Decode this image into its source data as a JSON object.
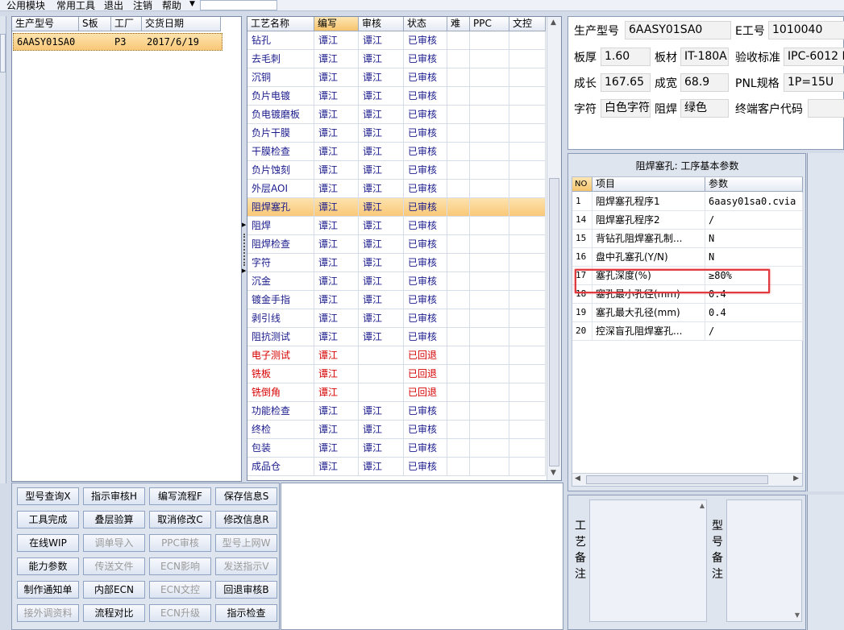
{
  "menu": [
    "公用模块",
    "常用工具",
    "退出",
    "注销",
    "帮助"
  ],
  "orders": {
    "headers": [
      "生产型号",
      "S板",
      "工厂",
      "交货日期"
    ],
    "rows": [
      [
        "6AASY01SA0",
        "",
        "P3",
        "2017/6/19"
      ]
    ]
  },
  "process": {
    "headers": [
      "工艺名称",
      "编写",
      "审核",
      "状态",
      "难",
      "PPC",
      "文控"
    ],
    "rows": [
      {
        "name": "钻孔",
        "writer": "谭江",
        "reviewer": "谭江",
        "status": "已审核"
      },
      {
        "name": "去毛刺",
        "writer": "谭江",
        "reviewer": "谭江",
        "status": "已审核"
      },
      {
        "name": "沉铜",
        "writer": "谭江",
        "reviewer": "谭江",
        "status": "已审核"
      },
      {
        "name": "负片电镀",
        "writer": "谭江",
        "reviewer": "谭江",
        "status": "已审核"
      },
      {
        "name": "负电镀磨板",
        "writer": "谭江",
        "reviewer": "谭江",
        "status": "已审核"
      },
      {
        "name": "负片干膜",
        "writer": "谭江",
        "reviewer": "谭江",
        "status": "已审核"
      },
      {
        "name": "干膜检查",
        "writer": "谭江",
        "reviewer": "谭江",
        "status": "已审核"
      },
      {
        "name": "负片蚀刻",
        "writer": "谭江",
        "reviewer": "谭江",
        "status": "已审核"
      },
      {
        "name": "外层AOI",
        "writer": "谭江",
        "reviewer": "谭江",
        "status": "已审核"
      },
      {
        "name": "阻焊塞孔",
        "writer": "谭江",
        "reviewer": "谭江",
        "status": "已审核"
      },
      {
        "name": "阻焊",
        "writer": "谭江",
        "reviewer": "谭江",
        "status": "已审核"
      },
      {
        "name": "阻焊检查",
        "writer": "谭江",
        "reviewer": "谭江",
        "status": "已审核"
      },
      {
        "name": "字符",
        "writer": "谭江",
        "reviewer": "谭江",
        "status": "已审核"
      },
      {
        "name": "沉金",
        "writer": "谭江",
        "reviewer": "谭江",
        "status": "已审核"
      },
      {
        "name": "镀金手指",
        "writer": "谭江",
        "reviewer": "谭江",
        "status": "已审核"
      },
      {
        "name": "剥引线",
        "writer": "谭江",
        "reviewer": "谭江",
        "status": "已审核"
      },
      {
        "name": "阻抗测试",
        "writer": "谭江",
        "reviewer": "谭江",
        "status": "已审核"
      },
      {
        "name": "电子测试",
        "writer": "谭江",
        "reviewer": "",
        "status": "已回退"
      },
      {
        "name": "铣板",
        "writer": "谭江",
        "reviewer": "",
        "status": "已回退"
      },
      {
        "name": "铣倒角",
        "writer": "谭江",
        "reviewer": "",
        "status": "已回退"
      },
      {
        "name": "功能检查",
        "writer": "谭江",
        "reviewer": "谭江",
        "status": "已审核"
      },
      {
        "name": "终检",
        "writer": "谭江",
        "reviewer": "谭江",
        "status": "已审核"
      },
      {
        "name": "包装",
        "writer": "谭江",
        "reviewer": "谭江",
        "status": "已审核"
      },
      {
        "name": "成品仓",
        "writer": "谭江",
        "reviewer": "谭江",
        "status": "已审核"
      }
    ]
  },
  "buttons": [
    {
      "label": "型号查询X",
      "enabled": true
    },
    {
      "label": "指示审核H",
      "enabled": true
    },
    {
      "label": "编写流程F",
      "enabled": true
    },
    {
      "label": "保存信息S",
      "enabled": true
    },
    {
      "label": "工具完成",
      "enabled": true
    },
    {
      "label": "叠层验算",
      "enabled": true
    },
    {
      "label": "取消修改C",
      "enabled": true
    },
    {
      "label": "修改信息R",
      "enabled": true
    },
    {
      "label": "在线WIP",
      "enabled": true
    },
    {
      "label": "调单导入",
      "enabled": false
    },
    {
      "label": "PPC审核",
      "enabled": false
    },
    {
      "label": "型号上网W",
      "enabled": false
    },
    {
      "label": "能力参数",
      "enabled": true
    },
    {
      "label": "传送文件",
      "enabled": false
    },
    {
      "label": "ECN影响",
      "enabled": false
    },
    {
      "label": "发送指示V",
      "enabled": false
    },
    {
      "label": "制作通知单",
      "enabled": true
    },
    {
      "label": "内部ECN",
      "enabled": true
    },
    {
      "label": "ECN文控",
      "enabled": false
    },
    {
      "label": "回退审核B",
      "enabled": true
    },
    {
      "label": "接外调资料",
      "enabled": false
    },
    {
      "label": "流程对比",
      "enabled": true
    },
    {
      "label": "ECN升级",
      "enabled": false
    },
    {
      "label": "指示检查",
      "enabled": true
    }
  ],
  "info": {
    "model_label": "生产型号",
    "model_value": "6AASY01SA0",
    "e_label": "E工号",
    "e_value": "1010040",
    "thickness_label": "板厚",
    "thickness_value": "1.60",
    "material_label": "板材",
    "material_value": "IT-180A",
    "standard_label": "验收标准",
    "standard_value": "IPC-6012 I",
    "length_label": "成长",
    "length_value": "167.65",
    "width_label": "成宽",
    "width_value": "68.9",
    "pnl_label": "PNL规格",
    "pnl_value": "1P=15U",
    "char_label": "字符",
    "char_value": "白色字符",
    "solder_label": "阻焊",
    "solder_value": "绿色",
    "customer_label": "终端客户代码",
    "customer_value": ""
  },
  "params": {
    "title": "阻焊塞孔: 工序基本参数",
    "headers": [
      "NO",
      "项目",
      "参数"
    ],
    "rows": [
      {
        "no": "1",
        "item": "阻焊塞孔程序1",
        "value": "6aasy01sa0.cvia"
      },
      {
        "no": "14",
        "item": "阻焊塞孔程序2",
        "value": "/"
      },
      {
        "no": "15",
        "item": "背钻孔阻焊塞孔制...",
        "value": "N"
      },
      {
        "no": "16",
        "item": "盘中孔塞孔(Y/N)",
        "value": "N"
      },
      {
        "no": "17",
        "item": "塞孔深度(%)",
        "value": "≥80%"
      },
      {
        "no": "18",
        "item": "塞孔最小孔径(mm)",
        "value": "0.4"
      },
      {
        "no": "19",
        "item": "塞孔最大孔径(mm)",
        "value": "0.4"
      },
      {
        "no": "20",
        "item": "控深盲孔阻焊塞孔...",
        "value": "/"
      }
    ]
  },
  "notes": {
    "process_label": "工艺备注",
    "model_label": "型号备注"
  },
  "colors": {
    "accent": "#f9c877",
    "highlight_box": "#e0393e",
    "returned_text": "#d60000",
    "normal_text": "#1a1a8c"
  }
}
